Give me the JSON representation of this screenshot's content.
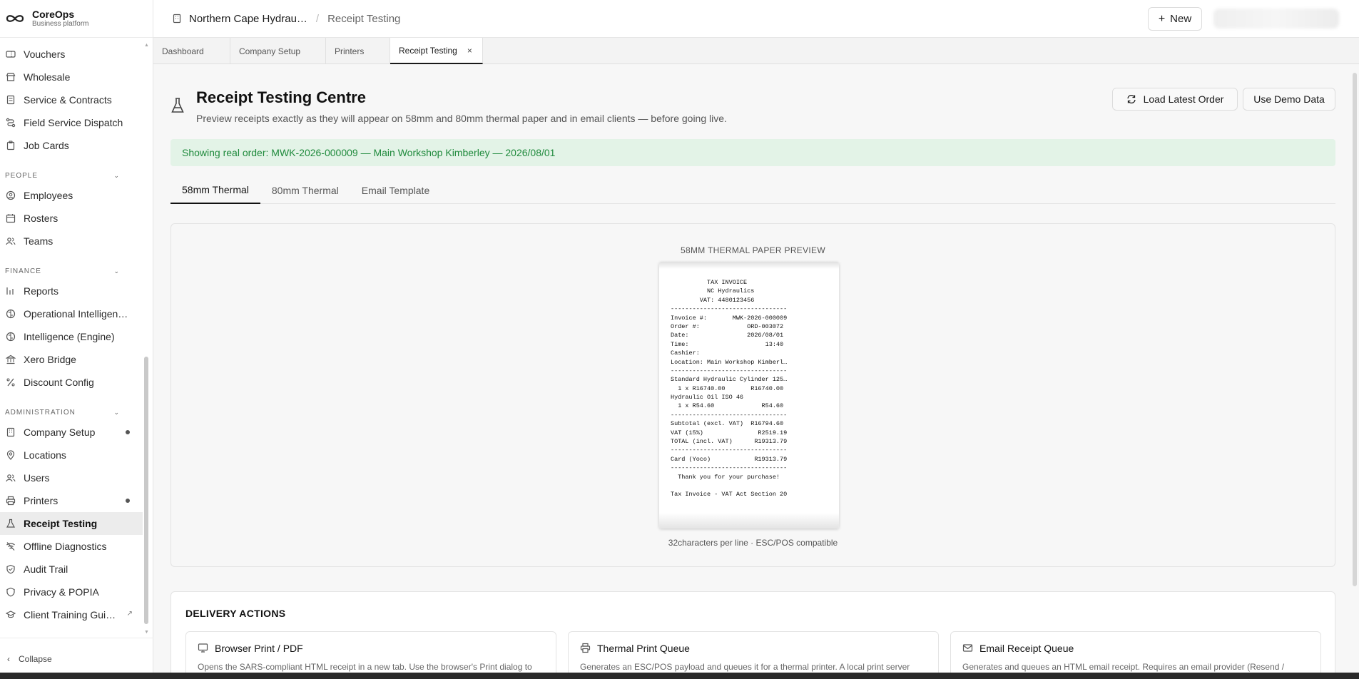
{
  "brand": {
    "name": "CoreOps",
    "sub": "Business platform"
  },
  "sidebar": {
    "items_top": [
      {
        "label": "Vouchers",
        "icon": "ticket-icon"
      },
      {
        "label": "Wholesale",
        "icon": "store-icon"
      },
      {
        "label": "Service & Contracts",
        "icon": "contract-icon"
      },
      {
        "label": "Field Service Dispatch",
        "icon": "route-icon"
      },
      {
        "label": "Job Cards",
        "icon": "clipboard-icon"
      }
    ],
    "section_people": "PEOPLE",
    "items_people": [
      {
        "label": "Employees",
        "icon": "user-circle-icon"
      },
      {
        "label": "Rosters",
        "icon": "calendar-icon"
      },
      {
        "label": "Teams",
        "icon": "users-icon"
      }
    ],
    "section_finance": "FINANCE",
    "items_finance": [
      {
        "label": "Reports",
        "icon": "bar-chart-icon"
      },
      {
        "label": "Operational Intelligen…",
        "icon": "brain-icon"
      },
      {
        "label": "Intelligence (Engine)",
        "icon": "brain-icon"
      },
      {
        "label": "Xero Bridge",
        "icon": "bank-icon"
      },
      {
        "label": "Discount Config",
        "icon": "percent-icon"
      }
    ],
    "section_admin": "ADMINISTRATION",
    "items_admin": [
      {
        "label": "Company Setup",
        "icon": "building-icon"
      },
      {
        "label": "Locations",
        "icon": "map-pin-icon"
      },
      {
        "label": "Users",
        "icon": "users-icon"
      },
      {
        "label": "Printers",
        "icon": "printer-icon"
      },
      {
        "label": "Receipt Testing",
        "icon": "flask-icon"
      },
      {
        "label": "Offline Diagnostics",
        "icon": "wifi-off-icon"
      },
      {
        "label": "Audit Trail",
        "icon": "shield-check-icon"
      },
      {
        "label": "Privacy & POPIA",
        "icon": "shield-icon"
      },
      {
        "label": "Client Training Gui…",
        "icon": "graduation-cap-icon"
      }
    ],
    "collapse_label": "Collapse"
  },
  "header": {
    "company": "Northern Cape Hydrau…",
    "separator": "/",
    "page": "Receipt Testing",
    "new_label": "New"
  },
  "tabs": [
    {
      "label": "Dashboard"
    },
    {
      "label": "Company Setup"
    },
    {
      "label": "Printers"
    },
    {
      "label": "Receipt Testing",
      "close": "×"
    }
  ],
  "page": {
    "title": "Receipt Testing Centre",
    "subtitle": "Preview receipts exactly as they will appear on 58mm and 80mm thermal paper and in email clients — before going live.",
    "load_latest_label": "Load Latest Order",
    "demo_label": "Use Demo Data",
    "alert": "Showing real order: MWK-2026-000009 — Main Workshop Kimberley — 2026/08/01",
    "format_tabs": [
      "58mm Thermal",
      "80mm Thermal",
      "Email Template"
    ],
    "preview_label": "58MM THERMAL PAPER PREVIEW",
    "preview_foot": "32characters per line · ESC/POS compatible",
    "receipt_lines": [
      "          TAX INVOICE",
      "          NC Hydraulics",
      "        VAT: 4480123456",
      "--------------------------------",
      "Invoice #:       MWK-2026-000009",
      "Order #:             ORD-003072",
      "Date:                2026/08/01",
      "Time:                     13:40",
      "Cashier:",
      "Location: Main Workshop Kimberl…",
      "--------------------------------",
      "Standard Hydraulic Cylinder 125…",
      "  1 x R16740.00       R16740.00",
      "Hydraulic Oil ISO 46",
      "  1 x R54.60             R54.60",
      "--------------------------------",
      "Subtotal (excl. VAT)  R16794.60",
      "VAT (15%)               R2519.19",
      "TOTAL (incl. VAT)      R19313.79",
      "--------------------------------",
      "Card (Yoco)            R19313.79",
      "--------------------------------",
      "  Thank you for your purchase!",
      "",
      "Tax Invoice - VAT Act Section 20"
    ],
    "delivery_title": "DELIVERY ACTIONS",
    "delivery_cards": [
      {
        "title": "Browser Print / PDF",
        "icon": "monitor-icon",
        "desc": "Opens the SARS-compliant HTML receipt in a new tab. Use the browser's Print dialog to"
      },
      {
        "title": "Thermal Print Queue",
        "icon": "printer-icon",
        "desc": "Generates an ESC/POS payload and queues it for a thermal printer. A local print server"
      },
      {
        "title": "Email Receipt Queue",
        "icon": "mail-icon",
        "desc": "Generates and queues an HTML email receipt. Requires an email provider (Resend /"
      }
    ]
  }
}
